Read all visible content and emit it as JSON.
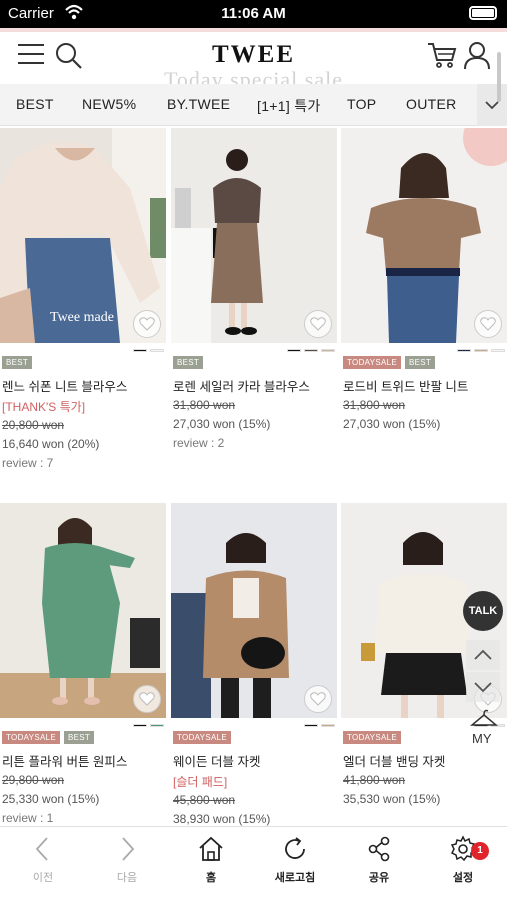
{
  "status_bar": {
    "carrier": "Carrier",
    "time": "11:06 AM"
  },
  "header": {
    "logo": "TWEE",
    "marquee": "Today special sale"
  },
  "tabs": [
    {
      "label": "BEST"
    },
    {
      "label": "NEW5%"
    },
    {
      "label": "BY.TWEE"
    },
    {
      "label": "[1+1] 특가"
    },
    {
      "label": "TOP"
    },
    {
      "label": "OUTER"
    }
  ],
  "products": [
    {
      "photo_caption": "Twee made",
      "swatches": [
        "#111111",
        "#f4f4f4"
      ],
      "badges": [
        "BEST"
      ],
      "name": "렌느 쉬폰 니트 블라우스",
      "promo": "[THANK'S 특가]",
      "orig_price": "20,800 won",
      "sale_price": "16,640 won (20%)",
      "review": "review : 7"
    },
    {
      "photo_caption": "",
      "swatches": [
        "#111111",
        "#5a4a44",
        "#c8b49a"
      ],
      "badges": [
        "BEST"
      ],
      "name": "로렌 세일러 카라 블라우스",
      "promo": "",
      "orig_price": "31,800 won",
      "sale_price": "27,030 won (15%)",
      "review": "review : 2"
    },
    {
      "photo_caption": "",
      "swatches": [
        "#1f2a4a",
        "#c9a88a",
        "#f4f4f4"
      ],
      "badges": [
        "TODAYSALE",
        "BEST"
      ],
      "name": "로드비 트위드 반팔 니트",
      "promo": "",
      "orig_price": "31,800 won",
      "sale_price": "27,030 won (15%)",
      "review": ""
    },
    {
      "photo_caption": "",
      "swatches": [
        "#111111",
        "#4e9a75"
      ],
      "badges": [
        "TODAYSALE",
        "BEST"
      ],
      "name": "리튼 플라워 버튼 원피스",
      "promo": "",
      "orig_price": "29,800 won",
      "sale_price": "25,330 won (15%)",
      "review": "review : 1"
    },
    {
      "photo_caption": "",
      "swatches": [
        "#111111",
        "#c9a88a"
      ],
      "badges": [
        "TODAYSALE"
      ],
      "name": "웨이든 더블 자켓",
      "promo": "[슬더 패드]",
      "orig_price": "45,800 won",
      "sale_price": "38,930 won (15%)",
      "review": ""
    },
    {
      "photo_caption": "",
      "swatches": [
        "#111111",
        "#f0ece2"
      ],
      "badges": [
        "TODAYSALE"
      ],
      "name": "엘더 더블 밴딩 자켓",
      "promo": "",
      "orig_price": "41,800 won",
      "sale_price": "35,530 won (15%)",
      "review": ""
    }
  ],
  "floating": {
    "talk": "TALK",
    "my": "MY"
  },
  "bottom_nav": {
    "back": "이전",
    "forward": "다음",
    "home": "홈",
    "refresh": "새로고침",
    "share": "공유",
    "settings": "설정",
    "settings_badge": "1"
  },
  "colors": {
    "badge_best": "#9aa193",
    "badge_today": "#c88a80",
    "promo": "#d06060",
    "notification": "#e0242b"
  }
}
